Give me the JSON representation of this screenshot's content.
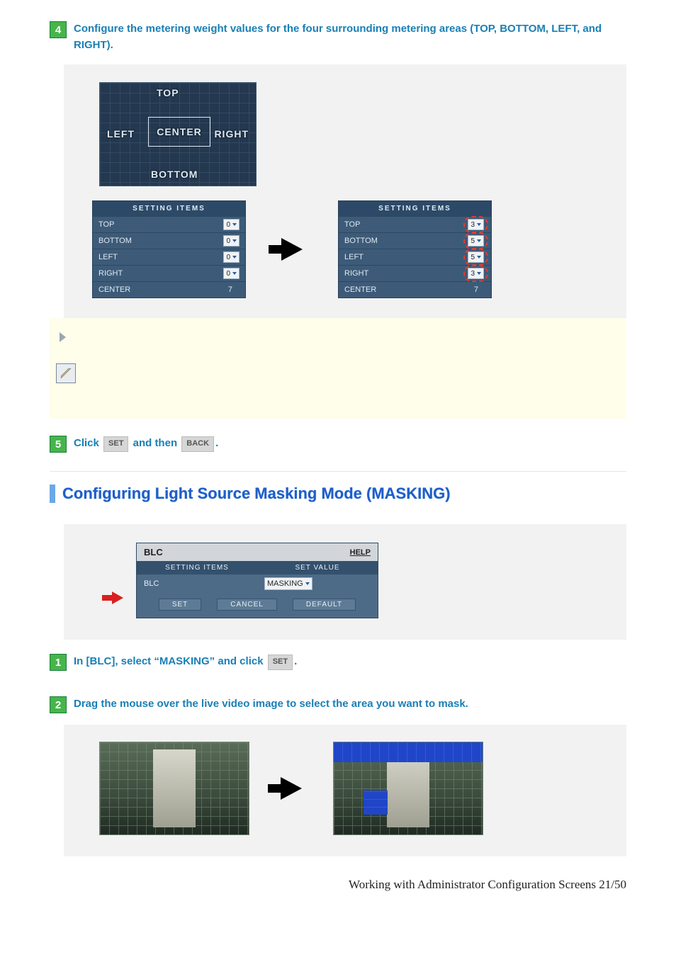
{
  "step4": {
    "number": "4",
    "text": "Configure the metering weight values for the four surrounding metering areas (TOP, BOTTOM, LEFT, and RIGHT)."
  },
  "meter_labels": {
    "top": "TOP",
    "left": "LEFT",
    "center": "CENTER",
    "right": "RIGHT",
    "bottom": "BOTTOM"
  },
  "settings_header": "SETTING ITEMS",
  "settings_before": [
    {
      "k": "TOP",
      "v": "0"
    },
    {
      "k": "BOTTOM",
      "v": "0"
    },
    {
      "k": "LEFT",
      "v": "0"
    },
    {
      "k": "RIGHT",
      "v": "0"
    },
    {
      "k": "CENTER",
      "v": "7"
    }
  ],
  "settings_after": [
    {
      "k": "TOP",
      "v": "3"
    },
    {
      "k": "BOTTOM",
      "v": "5"
    },
    {
      "k": "LEFT",
      "v": "5"
    },
    {
      "k": "RIGHT",
      "v": "3"
    },
    {
      "k": "CENTER",
      "v": "7"
    }
  ],
  "step5": {
    "number": "5",
    "prefix": "Click ",
    "btn1": "SET",
    "mid": " and then ",
    "btn2": "BACK",
    "suffix": "."
  },
  "section_title": "Configuring Light Source Masking Mode (MASKING)",
  "blc": {
    "title": "BLC",
    "help": "HELP",
    "col1": "SETTING ITEMS",
    "col2": "SET VALUE",
    "row_label": "BLC",
    "row_value": "MASKING",
    "btn_set": "SET",
    "btn_cancel": "CANCEL",
    "btn_default": "DEFAULT"
  },
  "step_b1": {
    "number": "1",
    "prefix": "In [BLC], select “MASKING” and click ",
    "btn": "SET",
    "suffix": "."
  },
  "step_b2": {
    "number": "2",
    "text": "Drag the mouse over the live video image to select the area you want to mask."
  },
  "footer": "Working with Administrator Configuration Screens 21/50"
}
